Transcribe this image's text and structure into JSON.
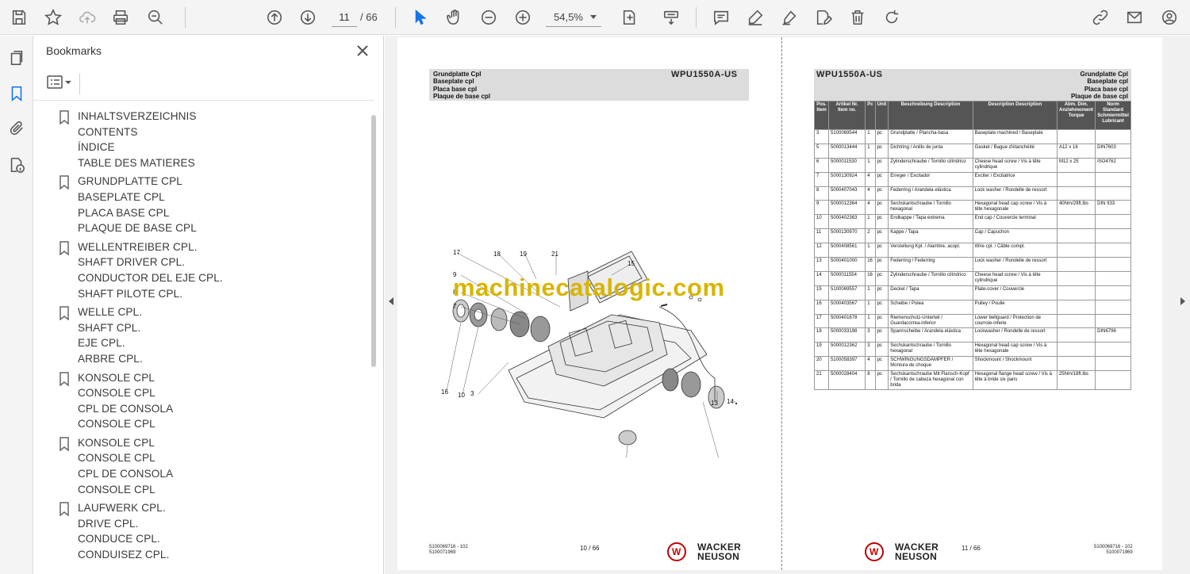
{
  "toolbar": {
    "current_page": "11",
    "total_pages": "/ 66",
    "zoom": "54,5%"
  },
  "bookmarks": {
    "title": "Bookmarks",
    "items": [
      {
        "lines": [
          "INHALTSVERZEICHNIS",
          "CONTENTS",
          "ÍNDICE",
          "TABLE DES MATIERES"
        ]
      },
      {
        "lines": [
          "GRUNDPLATTE CPL",
          "BASEPLATE CPL",
          "PLACA BASE CPL",
          "PLAQUE DE BASE CPL"
        ]
      },
      {
        "lines": [
          "WELLENTREIBER CPL.",
          "SHAFT DRIVER CPL.",
          "CONDUCTOR DEL EJE CPL.",
          "SHAFT PILOTE CPL."
        ]
      },
      {
        "lines": [
          "WELLE CPL.",
          "SHAFT CPL.",
          "EJE CPL.",
          "ARBRE CPL."
        ]
      },
      {
        "lines": [
          "KONSOLE CPL",
          "CONSOLE CPL",
          "CPL DE CONSOLA",
          "CONSOLE CPL"
        ]
      },
      {
        "lines": [
          "KONSOLE CPL",
          "CONSOLE CPL",
          "CPL DE CONSOLA",
          "CONSOLE CPL"
        ]
      },
      {
        "lines": [
          "LAUFWERK CPL.",
          "DRIVE CPL.",
          "CONDUCE CPL.",
          "CONDUISEZ CPL."
        ]
      }
    ]
  },
  "left_page": {
    "header_lines": [
      "Grundplatte Cpl",
      "Baseplate cpl",
      "Placa base cpl",
      "Plaque de base cpl"
    ],
    "model": "WPU1550A-US",
    "callouts": [
      "17",
      "18",
      "19",
      "21",
      "15",
      "9",
      "8",
      "7",
      "16",
      "10",
      "3",
      "20",
      "13",
      "14",
      "12"
    ],
    "watermark": "machinecatalogic.com",
    "footer_code_1": "5100069716 - 102",
    "footer_code_2": "5100071969",
    "page_label": "10 / 66",
    "logo_line_1": "WACKER",
    "logo_line_2": "NEUSON"
  },
  "right_page": {
    "model": "WPU1550A-US",
    "header_lines": [
      "Grundplatte Cpl",
      "Baseplate cpl",
      "Placa base cpl",
      "Plaque de base cpl"
    ],
    "table_headers": [
      "Pos. Item",
      "Artikel Nr. Item no.",
      "Pc",
      "Unit",
      "Beschreibung Description",
      "Description Description",
      "Abm. Dim. Anziehmoment Torque",
      "Norm Standard Schmiermittel Lubricant"
    ],
    "rows": [
      [
        "3",
        "5100069544",
        "1",
        "pc",
        "Grundplatte / Plancha-basa",
        "Baseplate machined / Baseplate",
        "",
        ""
      ],
      [
        "5",
        "5000013444",
        "1",
        "pc",
        "Dichtring / Anillo de junta",
        "Gasket / Bague d'étanchéité",
        "A12 x 16",
        "DIN7603"
      ],
      [
        "6",
        "5000011530",
        "1",
        "pc",
        "Zylinderschraube / Tornillo cilíndrico",
        "Cheese head screw / Vis à tête cylindrique",
        "M12 x 25",
        "ISO4762"
      ],
      [
        "7",
        "5000130924",
        "4",
        "pc",
        "Erreger / Excitador",
        "Exciter / Excitatrice",
        "",
        ""
      ],
      [
        "8",
        "5000407043",
        "4",
        "pc",
        "Federring / Arandela elástica",
        "Lock washer / Rondelle de ressort",
        "",
        ""
      ],
      [
        "9",
        "5000012364",
        "4",
        "pc",
        "Sechskantschraube / Tornillo hexagonal",
        "Hexagonal head cap screw / Vis à tête hexagonale",
        "40Nm/29ft.lbs",
        "DIN 933"
      ],
      [
        "10",
        "5000402363",
        "1",
        "pc",
        "Endkappe / Tapa extrema",
        "End cap / Couvercle terminal",
        "",
        ""
      ],
      [
        "11",
        "5000130970",
        "2",
        "pc",
        "Kappe / Tapa",
        "Cap / Capuchon",
        "",
        ""
      ],
      [
        "12",
        "5000408561",
        "1",
        "pc",
        "Verstellung Kpl. / Alambre, acopl.",
        "Wire cpl. / Câble compl.",
        "",
        ""
      ],
      [
        "13",
        "5000401000",
        "16",
        "pc",
        "Federring / Federring",
        "Lock washer / Rondelle de ressort",
        "",
        ""
      ],
      [
        "14",
        "5000011554",
        "16",
        "pc",
        "Zylinderschraube / Tornillo cilíndrico",
        "Cheese head screw / Vis à tête cylindrique",
        "",
        ""
      ],
      [
        "15",
        "5100069557",
        "1",
        "pc",
        "Deckel / Tapa",
        "Plate-cover / Couvercle",
        "",
        ""
      ],
      [
        "16",
        "5000403567",
        "1",
        "pc",
        "Scheibe / Polea",
        "Pulley / Poulie",
        "",
        ""
      ],
      [
        "17",
        "5000401678",
        "1",
        "pc",
        "Riemenschutz-Unterteil / Guardacorrea-inferior",
        "Lower beltguard / Protection de courroie-inferie",
        "",
        ""
      ],
      [
        "18",
        "5000033198",
        "3",
        "pc",
        "Spannscheibe / Arandela elástica",
        "Lockwasher / Rondelle de ressort",
        "",
        "DIN6796"
      ],
      [
        "19",
        "5000012362",
        "3",
        "pc",
        "Sechskantschraube / Tornillo hexagonal",
        "Hexagonal head cap screw / Vis à tête hexagonale",
        "",
        ""
      ],
      [
        "20",
        "5100058397",
        "4",
        "pc",
        "SCHWINGUNGSDÄMPFER / Montura de choque",
        "Shockmount / Shockmount",
        "",
        ""
      ],
      [
        "21",
        "5000028404",
        "8",
        "pc",
        "Sechskantschraube Mit Flansch-Kopf / Tornillo de cabeza hexagonal con brida",
        "Hexagonal flange head screw / Vis à tête à bride six pans",
        "25Nm/18ft.lbs",
        ""
      ]
    ],
    "page_label": "11 / 66",
    "footer_code_1": "5100069716 - 102",
    "footer_code_2": "5100071969",
    "logo_line_1": "WACKER",
    "logo_line_2": "NEUSON"
  }
}
